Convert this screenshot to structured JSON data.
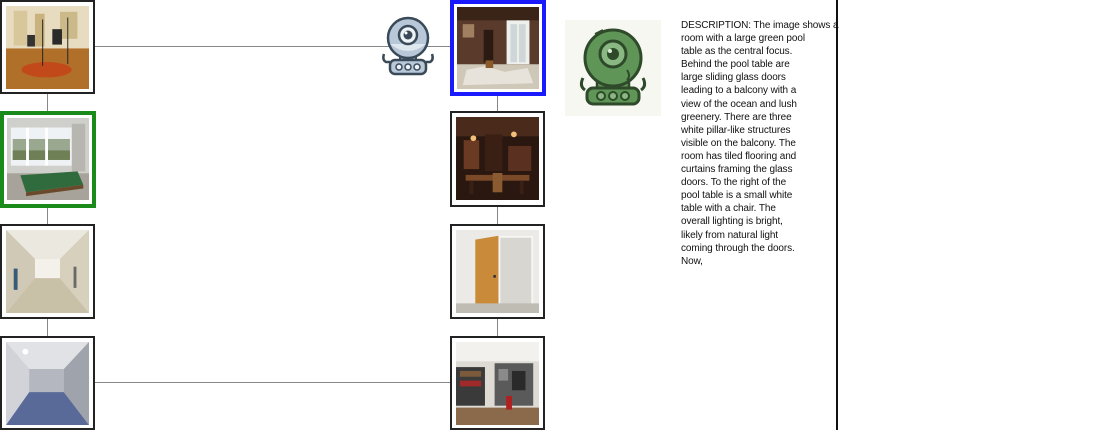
{
  "graph": {
    "left_nodes": [
      {
        "id": "studio",
        "scene": "recording-studio",
        "selected": "none"
      },
      {
        "id": "pool",
        "scene": "pool-table-room",
        "selected": "green"
      },
      {
        "id": "hallway",
        "scene": "hallway",
        "selected": "none"
      },
      {
        "id": "corridor",
        "scene": "blue-carpet-corridor",
        "selected": "none"
      }
    ],
    "right_nodes": [
      {
        "id": "foyer",
        "scene": "ornate-foyer",
        "selected": "blue"
      },
      {
        "id": "pub",
        "scene": "dark-wood-room",
        "selected": "none"
      },
      {
        "id": "doorway",
        "scene": "open-door",
        "selected": "none"
      },
      {
        "id": "basement",
        "scene": "storage-basement",
        "selected": "none"
      }
    ],
    "agent_icon": "robot-icon"
  },
  "panel": {
    "avatar_icon": "green-robot-icon",
    "description": "DESCRIPTION: The image shows a\nroom with a large green pool\ntable as the central focus.\nBehind the pool table are\nlarge sliding glass doors\nleading to a balcony with a\nview of the ocean and lush\ngreenery. There are three\nwhite pillar-like structures\nvisible on the balcony. The\nroom has tiled flooring and\ncurtains framing the glass\ndoors. To the right of the\npool table is a small white\ntable with a chair. The\noverall lighting is bright,\nlikely from natural light\ncoming through the doors.\nNow,"
  },
  "colors": {
    "selected_green": "#1a8a1a",
    "selected_blue": "#1a1aff",
    "robot_body": "#b8c8d8",
    "robot_green": "#4f8a4a"
  }
}
